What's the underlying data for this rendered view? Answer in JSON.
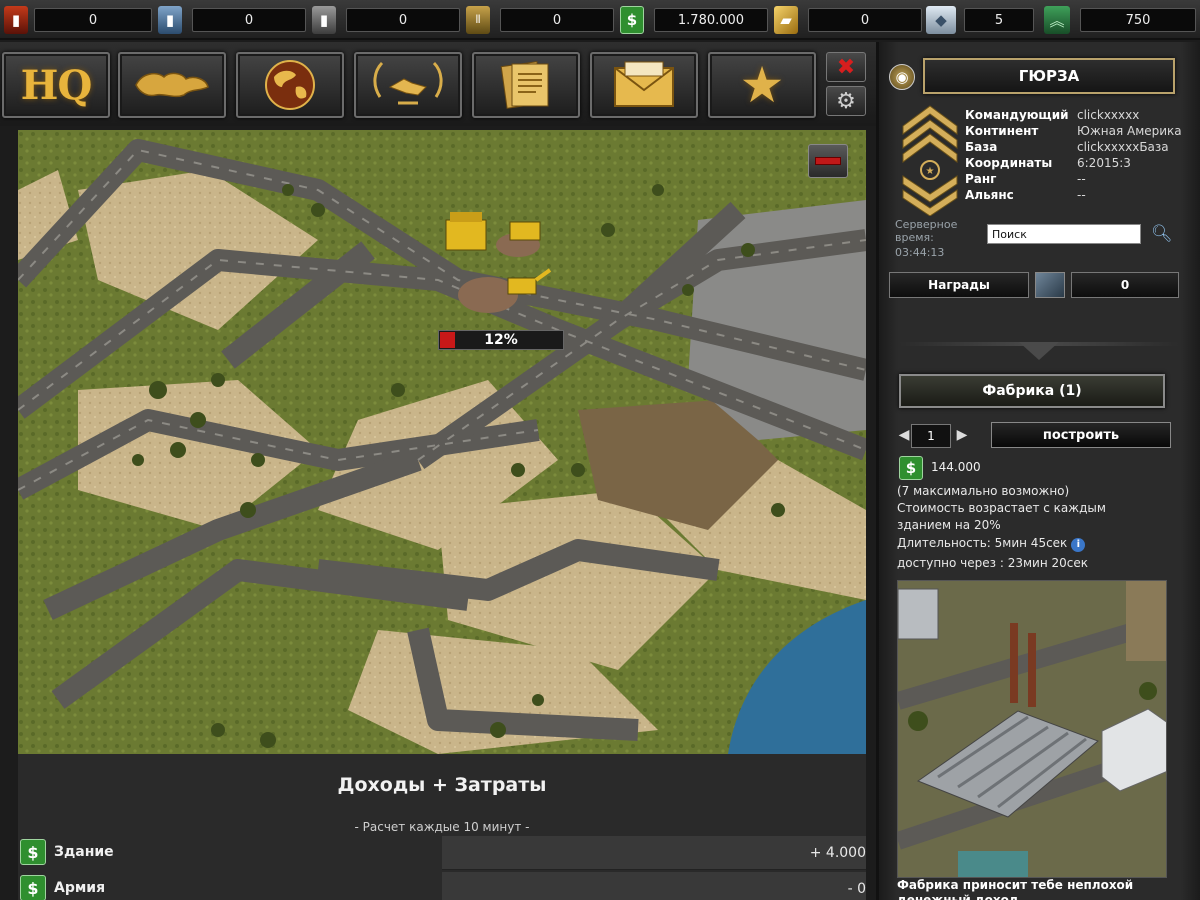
{
  "resources": [
    {
      "name": "oil",
      "icon": "oil-barrel-icon",
      "value": "0"
    },
    {
      "name": "uranium",
      "icon": "uranium-barrel-icon",
      "value": "0"
    },
    {
      "name": "steel",
      "icon": "steel-barrel-icon",
      "value": "0"
    },
    {
      "name": "ammo",
      "icon": "ammo-crate-icon",
      "value": "0"
    },
    {
      "name": "money",
      "icon": "dollar-icon",
      "value": "1.780.000"
    },
    {
      "name": "gold",
      "icon": "gold-bar-icon",
      "value": "0"
    },
    {
      "name": "diamonds",
      "icon": "diamond-icon",
      "value": "5"
    },
    {
      "name": "rank_points",
      "icon": "chevrons-up-icon",
      "value": "750"
    }
  ],
  "nav": {
    "hq_label": "HQ",
    "items": [
      "hq",
      "world-map",
      "globe",
      "alliance",
      "reports",
      "messages",
      "favorites"
    ]
  },
  "map": {
    "progress_text": "12%",
    "progress_value": 0.12
  },
  "income": {
    "title": "Доходы + Затраты",
    "subtitle": "- Расчет каждые 10 минут -",
    "rows": [
      {
        "label": "Здание",
        "value": "+ 4.000"
      },
      {
        "label": "Армия",
        "value": "- 0"
      }
    ]
  },
  "player": {
    "name": "ГЮРЗА",
    "fields": [
      {
        "key": "Командующий",
        "value": "clickxxxxx"
      },
      {
        "key": "Континент",
        "value": "Южная Америка"
      },
      {
        "key": "База",
        "value": "clickxxxxxБаза"
      },
      {
        "key": "Координаты",
        "value": "6:2015:3"
      },
      {
        "key": "Ранг",
        "value": "--"
      },
      {
        "key": "Альянс",
        "value": "--"
      }
    ],
    "server_time_label": "Серверное время:",
    "server_time": "03:44:13",
    "search_value": "Поиск"
  },
  "rewards": {
    "label": "Награды",
    "count": "0"
  },
  "building": {
    "title": "Фабрика  (1)",
    "quantity": "1",
    "build_label": "построить",
    "cost": "144.000",
    "max_note": "(7 максимально возможно)",
    "cost_note_1": "Стоимость возрастает с каждым",
    "cost_note_2": "зданием на 20%",
    "duration": "Длительность: 5мин 45сек",
    "available": "доступно через : 23мин 20сек",
    "caption": "Фабрика приносит тебе неплохой денежный доход"
  },
  "colors": {
    "accent_gold": "#e0b24a",
    "money_green": "#2f8f2f",
    "progress_red": "#c81818"
  }
}
